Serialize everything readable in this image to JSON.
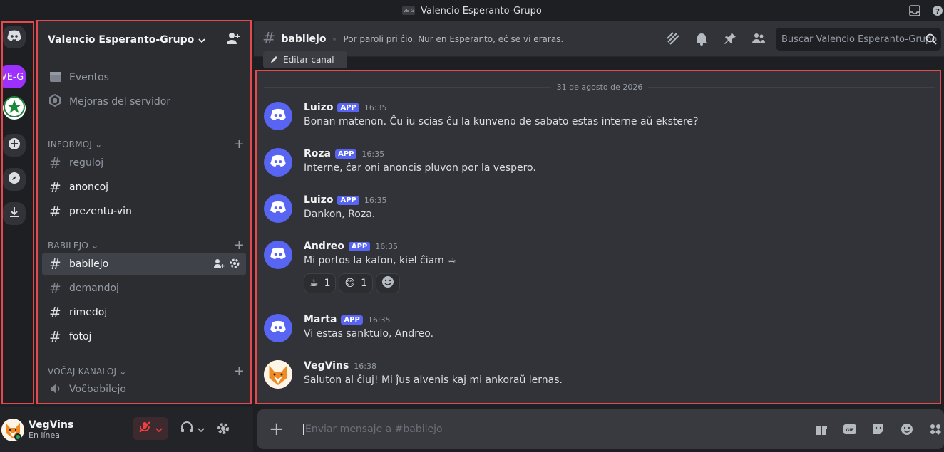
{
  "window": {
    "title": "Valencio Esperanto-Grupo",
    "title_icon": "VE-G"
  },
  "rail": {
    "items": [
      {
        "name": "home",
        "icon": "discord-logo-icon"
      },
      {
        "name": "server-veg",
        "label": "VE-G"
      },
      {
        "name": "server-esperanto",
        "icon": "green-star-icon"
      },
      {
        "name": "add-server",
        "icon": "plus-icon"
      },
      {
        "name": "explore",
        "icon": "compass-icon"
      },
      {
        "name": "download",
        "icon": "download-icon"
      }
    ]
  },
  "guild": {
    "name": "Valencio Esperanto-Grupo"
  },
  "sidebar": {
    "top_items": [
      {
        "label": "Eventos",
        "icon": "calendar-icon"
      },
      {
        "label": "Mejoras del servidor",
        "icon": "boost-icon"
      }
    ],
    "categories": [
      {
        "name": "INFORMOJ",
        "channels": [
          "reguloj",
          "anoncoj",
          "prezentu-vin"
        ]
      },
      {
        "name": "BABILEJO",
        "channels": [
          "babilejo",
          "demandoj",
          "rimedoj",
          "fotoj"
        ]
      },
      {
        "name": "VOĈAJ KANALOJ",
        "channels": [
          "Voĉbabilejo"
        ]
      }
    ]
  },
  "user": {
    "name": "VegVins",
    "status": "En línea"
  },
  "channel": {
    "name": "babilejo",
    "topic": "Por paroli pri ĉio. Nur en Esperanto, eĉ se vi eraras.",
    "edit_label": "Editar canal",
    "search_placeholder": "Buscar Valencio Esperanto-Grupo"
  },
  "messages": {
    "date": "31 de agosto de 2026",
    "items": [
      {
        "author": "Luizo",
        "badge": "APP",
        "time": "16:35",
        "text": "Bonan matenon. Ĉu iu scias ĉu la kunveno de sabato estas interne aŭ ekstere?"
      },
      {
        "author": "Roza",
        "badge": "APP",
        "time": "16:35",
        "text": "Interne, ĉar oni anoncis pluvon por la vespero."
      },
      {
        "author": "Luizo",
        "badge": "APP",
        "time": "16:35",
        "text": "Dankon, Roza."
      },
      {
        "author": "Andreo",
        "badge": "APP",
        "time": "16:35",
        "text": "Mi portos la kafon, kiel ĉiam",
        "emoji": "☕"
      },
      {
        "author": "Marta",
        "badge": "APP",
        "time": "16:35",
        "text": "Vi estas sanktulo, Andreo."
      },
      {
        "author": "VegVins",
        "badge": "",
        "time": "16:38",
        "text": "Saluton al ĉiuj! Mi ĵus alvenis kaj mi ankoraŭ lernas."
      }
    ],
    "reactions": [
      {
        "emoji": "☕",
        "count": "1"
      },
      {
        "emoji": "😄",
        "count": "1"
      }
    ]
  },
  "composer": {
    "placeholder": "Enviar mensaje a #babilejo"
  },
  "colors": {
    "accent": "#5865f2",
    "highlight": "#e5484d",
    "mute_red": "#f23f43"
  }
}
